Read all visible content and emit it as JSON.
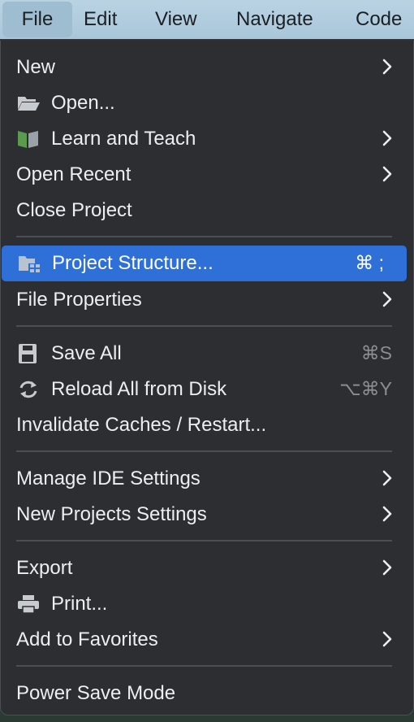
{
  "menubar": {
    "items": [
      "File",
      "Edit",
      "View",
      "Navigate",
      "Code"
    ]
  },
  "menu": {
    "new": "New",
    "open": "Open...",
    "learn": "Learn and Teach",
    "open_recent": "Open Recent",
    "close_project": "Close Project",
    "project_structure": "Project Structure...",
    "project_structure_shortcut": "⌘ ;",
    "file_properties": "File Properties",
    "save_all": "Save All",
    "save_all_shortcut": "⌘S",
    "reload": "Reload All from Disk",
    "reload_shortcut": "⌥⌘Y",
    "invalidate": "Invalidate Caches / Restart...",
    "manage_ide": "Manage IDE Settings",
    "new_projects_settings": "New Projects Settings",
    "export": "Export",
    "print": "Print...",
    "add_favorites": "Add to Favorites",
    "power_save": "Power Save Mode"
  },
  "colors": {
    "menu_bg": "#2c2e31",
    "highlight": "#2f6fd8",
    "text": "#eceff2",
    "shortcut": "#8a8e93",
    "menubar_bg": "#b9d3e3"
  }
}
